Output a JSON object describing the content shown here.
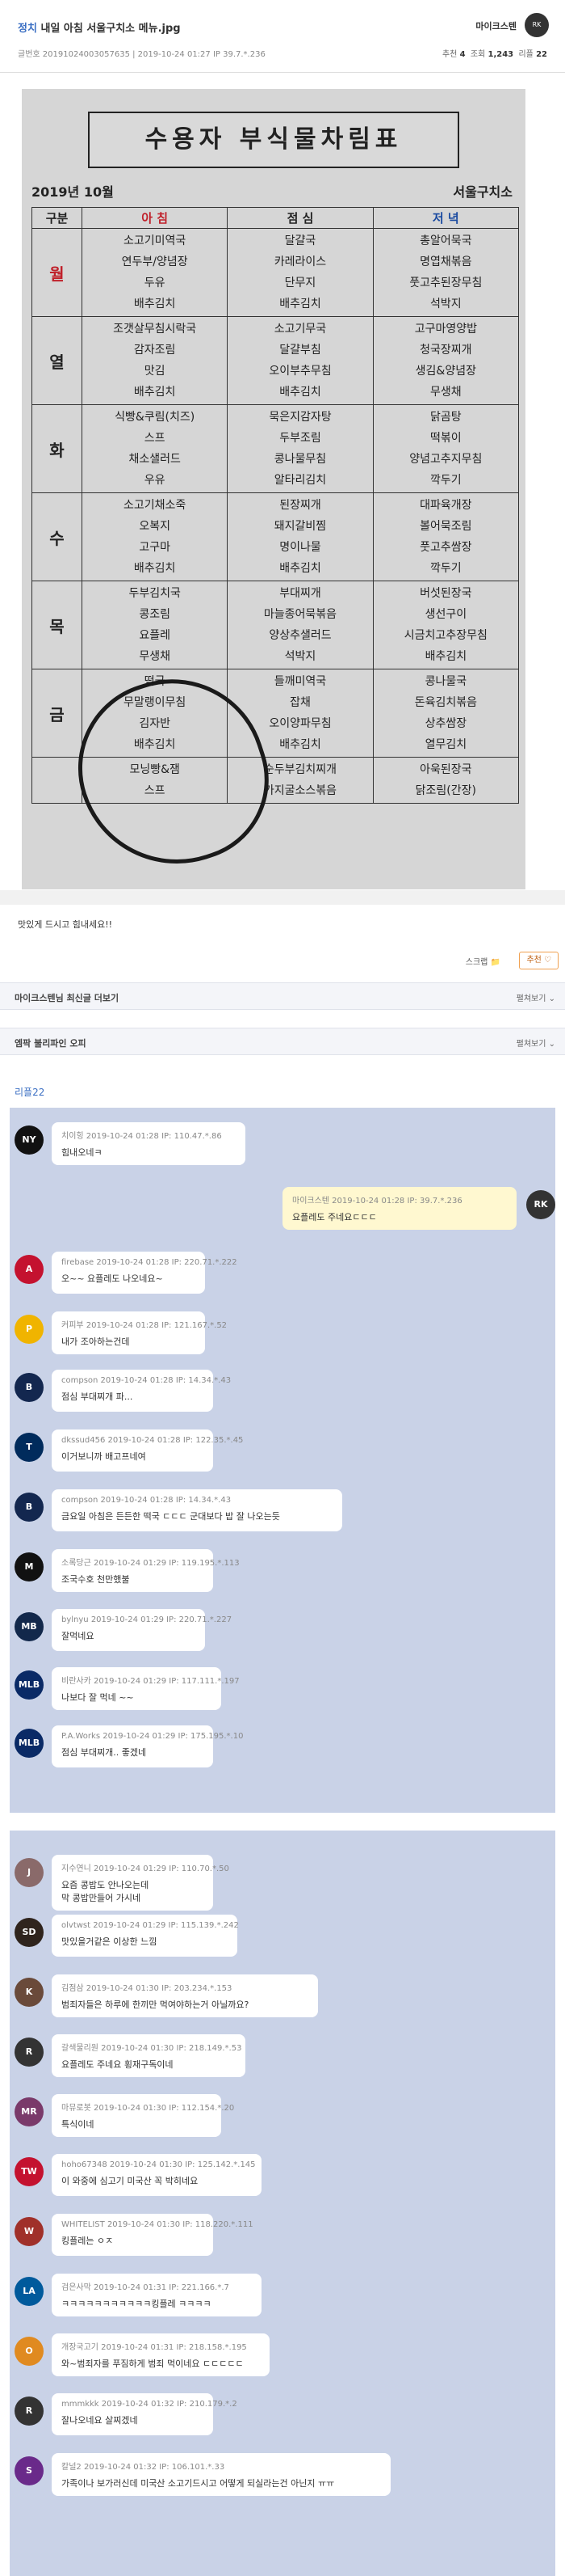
{
  "post": {
    "category": "정치",
    "title": "내일 아침 서울구치소 메뉴.jpg",
    "meta": "글번호 20191024003057635 | 2019-10-24 01:27     IP 39.7.*.236",
    "author": "마이크스텐",
    "recommend_label": "추천",
    "recommend": "4",
    "views_label": "조회",
    "views": "1,243",
    "replies_label": "리플",
    "replies": "22",
    "body_text": "맛있게 드시고 힘내세요!!",
    "scrap_label": "스크랩 📁",
    "recommend_button": "추천 ♡",
    "author_more": "마이크스텐님 최신글 더보기",
    "gallery": "엠팍 불리파인 오피",
    "view_all": "펼쳐보기 ⌄",
    "reply_count_label": "리플22"
  },
  "menu_image": {
    "title": "수용자 부식물차림표",
    "year_month": "2019년 10월",
    "facility": "서울구치소",
    "columns": [
      "구분",
      "아 침",
      "점 심",
      "저 녁"
    ],
    "rows": [
      {
        "day": "월",
        "breakfast": [
          "소고기미역국",
          "연두부/양념장",
          "두유",
          "배추김치"
        ],
        "lunch": [
          "달걀국",
          "카레라이스",
          "단무지",
          "배추김치"
        ],
        "dinner": [
          "총알어묵국",
          "명엽채볶음",
          "풋고추된장무침",
          "석박지"
        ]
      },
      {
        "day": "열",
        "breakfast": [
          "조갯살무침시락국",
          "감자조림",
          "맛김",
          "배추김치"
        ],
        "lunch": [
          "소고기무국",
          "달걀부침",
          "오이부추무침",
          "배추김치"
        ],
        "dinner": [
          "고구마영양밥",
          "청국장찌개",
          "생김&양념장",
          "무생채"
        ]
      },
      {
        "day": "화",
        "breakfast": [
          "식빵&쿠림(치즈)",
          "스프",
          "채소샐러드",
          "우유"
        ],
        "lunch": [
          "묵은지감자탕",
          "두부조림",
          "콩나물무침",
          "알타리김치"
        ],
        "dinner": [
          "닭곰탕",
          "떡볶이",
          "양념고추지무침",
          "깍두기"
        ]
      },
      {
        "day": "수",
        "breakfast": [
          "소고기채소죽",
          "오복지",
          "고구마",
          "배추김치"
        ],
        "lunch": [
          "된장찌개",
          "돼지갈비찜",
          "명이나물",
          "배추김치"
        ],
        "dinner": [
          "대파육개장",
          "볼어묵조림",
          "풋고추쌈장",
          "깍두기"
        ]
      },
      {
        "day": "목",
        "breakfast": [
          "두부김치국",
          "콩조림",
          "요플레",
          "무생채"
        ],
        "lunch": [
          "부대찌개",
          "마늘종어묵볶음",
          "양상추샐러드",
          "석박지"
        ],
        "dinner": [
          "버섯된장국",
          "생선구이",
          "시금치고추장무침",
          "배추김치"
        ]
      },
      {
        "day": "금",
        "breakfast": [
          "떡국",
          "무말랭이무침",
          "김자반",
          "배추김치"
        ],
        "lunch": [
          "들깨미역국",
          "잡채",
          "오이양파무침",
          "배추김치"
        ],
        "dinner": [
          "콩나물국",
          "돈육김치볶음",
          "상추쌈장",
          "열무김치"
        ]
      },
      {
        "day": "",
        "breakfast": [
          "모닝빵&잼",
          "스프"
        ],
        "lunch": [
          "순두부김치찌개",
          "가지굴소스볶음"
        ],
        "dinner": [
          "아욱된장국",
          "닭조림(간장)"
        ]
      }
    ]
  },
  "comments": [
    {
      "user": "치이힝",
      "meta": "2019-10-24 01:28  IP: 110.47.*.86",
      "text": "힘내오네ㅋ",
      "avatar": "NY",
      "color": "#111111"
    },
    {
      "user": "마이크스텐",
      "meta": "2019-10-24 01:28  IP: 39.7.*.236",
      "text": "요플레도 주네요ㄷㄷㄷ",
      "avatar": "RK",
      "color": "#333333",
      "mine": true
    },
    {
      "user": "firebase",
      "meta": "2019-10-24 01:28  IP: 220.71.*.222",
      "text": "오~~ 요플레도 나오네요~",
      "avatar": "A",
      "color": "#c4122f"
    },
    {
      "user": "커피부",
      "meta": "2019-10-24 01:28  IP: 121.167.*.52",
      "text": "내가 조아하는건데",
      "avatar": "P",
      "color": "#f0b400"
    },
    {
      "user": "compson",
      "meta": "2019-10-24 01:28  IP: 14.34.*.43",
      "text": "점심 부대찌개 파...",
      "avatar": "B",
      "color": "#13274f"
    },
    {
      "user": "dkssud456",
      "meta": "2019-10-24 01:28  IP: 122.35.*.45",
      "text": "이거보니까 배고프네여",
      "avatar": "T",
      "color": "#002b5c"
    },
    {
      "user": "compson",
      "meta": "2019-10-24 01:28  IP: 14.34.*.43",
      "text": "금요일 아침은 든든한 떡국 ㄷㄷㄷ 군대보다 밥 잘 나오는듯",
      "avatar": "B",
      "color": "#13274f"
    },
    {
      "user": "소록당근",
      "meta": "2019-10-24 01:29  IP: 119.195.*.113",
      "text": "조국수호 천만했불",
      "avatar": "M",
      "color": "#111111"
    },
    {
      "user": "bylnyu",
      "meta": "2019-10-24 01:29  IP: 220.71.*.227",
      "text": "잘먹네요",
      "avatar": "MB",
      "color": "#12284b"
    },
    {
      "user": "비란사카",
      "meta": "2019-10-24 01:29  IP: 117.111.*.197",
      "text": "나보다 잘 먹네 ~~",
      "avatar": "MLB",
      "color": "#0a2a66"
    },
    {
      "user": "P.A.Works",
      "meta": "2019-10-24 01:29  IP: 175.195.*.10",
      "text": "점심 부대찌개.. 좋겠네",
      "avatar": "MLB",
      "color": "#0a2a66"
    },
    {
      "user": "지수연니",
      "meta": "2019-10-24 01:29  IP: 110.70.*.50",
      "text": "요즘 콩밥도 안나오는데\n막 콩밥만들어 가시네",
      "avatar": "J",
      "color": "#8a6a6a"
    },
    {
      "user": "olvtwst",
      "meta": "2019-10-24 01:29  IP: 115.139.*.242",
      "text": "맛있을거같은 이상한 느낌",
      "avatar": "SD",
      "color": "#2f241d"
    },
    {
      "user": "김점삼",
      "meta": "2019-10-24 01:30  IP: 203.234.*.153",
      "text": "범죄자들은 하루에 한끼만 먹여야하는거 아닐까요?",
      "avatar": "K",
      "color": "#6a4a3a"
    },
    {
      "user": "갈색물리원",
      "meta": "2019-10-24 01:30  IP: 218.149.*.53",
      "text": "요플레도 주네요 횡재구독이네",
      "avatar": "R",
      "color": "#333333"
    },
    {
      "user": "마뮤로봇",
      "meta": "2019-10-24 01:30  IP: 112.154.*.20",
      "text": "특식이네",
      "avatar": "MR",
      "color": "#7a3a6a"
    },
    {
      "user": "hoho67348",
      "meta": "2019-10-24 01:30  IP: 125.142.*.145",
      "text": "이 와중에 심고기 미국산 꼭 박히네요",
      "avatar": "TW",
      "color": "#c4122f"
    },
    {
      "user": "WHITELIST",
      "meta": "2019-10-24 01:30  IP: 118.220.*.111",
      "text": "킹플레는 ㅇㅈ",
      "avatar": "W",
      "color": "#a0302a"
    },
    {
      "user": "검은사막",
      "meta": "2019-10-24 01:31  IP: 221.166.*.7",
      "text": "ㅋㅋㅋㅋㅋㅋㅋㅋㅋㅋㅋ킹플레 ㅋㅋㅋㅋ",
      "avatar": "LA",
      "color": "#005a9c"
    },
    {
      "user": "개장국고기",
      "meta": "2019-10-24 01:31  IP: 218.158.*.195",
      "text": "와~범죄자를 푸짐하게 범죄 먹이네요 ㄷㄷㄷㄷㄷ",
      "avatar": "O",
      "color": "#e08a20"
    },
    {
      "user": "mmmkkk",
      "meta": "2019-10-24 01:32  IP: 210.179.*.2",
      "text": "잘나오네요 살찌겠네",
      "avatar": "R",
      "color": "#333333"
    },
    {
      "user": "칼널2",
      "meta": "2019-10-24 01:32  IP: 106.101.*.33",
      "text": "가족이나 보가러신데 미국산 소고기드시고 어떻게 되실라는건 아닌지 ㅠㅠ",
      "avatar": "S",
      "color": "#6a2a8a"
    }
  ]
}
